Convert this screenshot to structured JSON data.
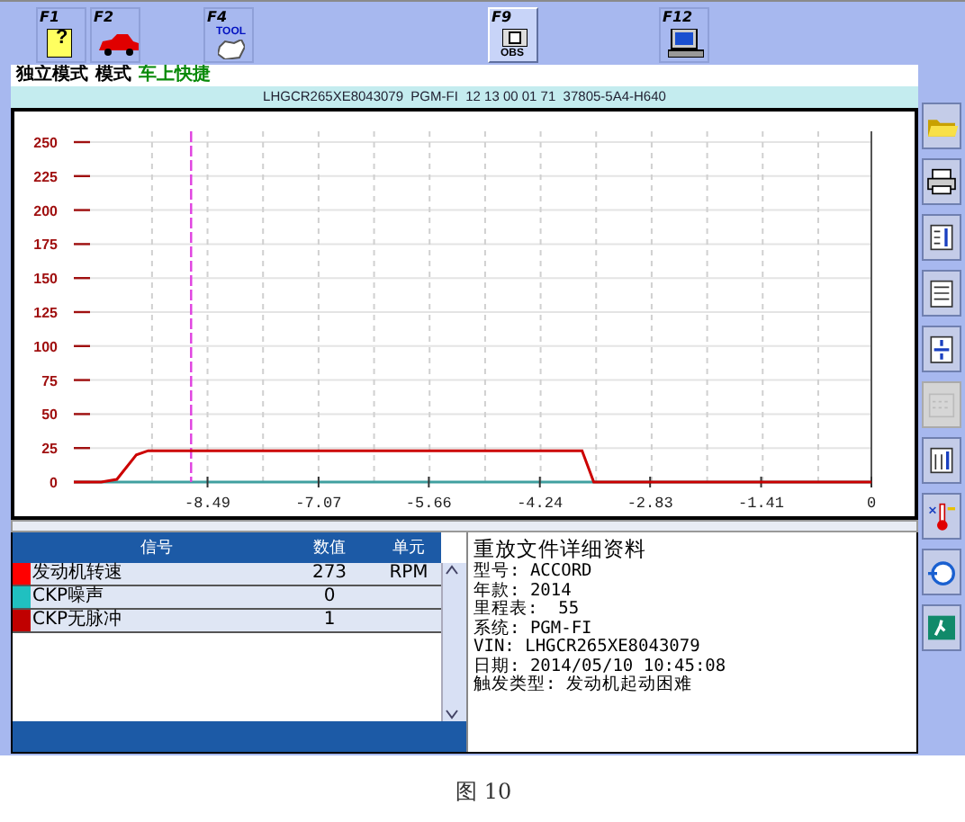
{
  "toolbar": {
    "keys": [
      {
        "label": "F1",
        "icon_text": "?",
        "selected": false
      },
      {
        "label": "F2",
        "selected": false
      },
      {
        "label": "F4",
        "icon_text": "TOOL",
        "selected": false
      },
      {
        "label": "F9",
        "icon_text": "OBS",
        "selected": true
      },
      {
        "label": "F12",
        "selected": false
      }
    ]
  },
  "mode_bar": {
    "parts": [
      {
        "text": "独立模式",
        "kind": "plain"
      },
      {
        "text": "模式",
        "kind": "plain"
      },
      {
        "text": "车上快捷",
        "kind": "highlight"
      }
    ]
  },
  "vehicle_strip": {
    "text": "LHGCR265XE8043079  PGM-FI  12 13 00 01 71  37805-5A4-H640"
  },
  "chart": {
    "chart_data": {
      "type": "line",
      "xlim": [
        -10.2,
        0
      ],
      "ylim": [
        0,
        250
      ],
      "yticks": [
        0,
        25,
        50,
        75,
        100,
        125,
        150,
        175,
        200,
        225,
        250
      ],
      "xticks": [
        {
          "value": -8.49,
          "label": "-8.49"
        },
        {
          "value": -7.07,
          "label": "-7.07"
        },
        {
          "value": -5.66,
          "label": "-5.66"
        },
        {
          "value": -4.24,
          "label": "-4.24"
        },
        {
          "value": -2.83,
          "label": "-2.83"
        },
        {
          "value": -1.41,
          "label": "-1.41"
        },
        {
          "value": 0,
          "label": "0"
        }
      ],
      "x": [
        -10.2,
        -9.85,
        -9.65,
        -9.4,
        -9.25,
        -3.7,
        -3.55,
        0
      ],
      "series": [
        {
          "color": "#cc0000",
          "values": [
            0,
            0,
            2,
            20,
            23,
            23,
            0,
            0
          ]
        }
      ],
      "grid": true,
      "ref_lines": [
        {
          "axis": "x",
          "value": -8.7,
          "color": "#e040e0"
        }
      ]
    }
  },
  "side_tools": [
    {
      "disabled": false
    },
    {
      "disabled": false
    },
    {
      "disabled": false
    },
    {
      "disabled": false
    },
    {
      "disabled": false
    },
    {
      "disabled": true
    },
    {
      "disabled": false
    },
    {
      "disabled": false
    },
    {
      "disabled": false
    },
    {
      "disabled": false
    }
  ],
  "signal_table": {
    "columns": [
      "信号",
      "数值",
      "单元"
    ],
    "rows": [
      {
        "color": "#ff0000",
        "name": "发动机转速",
        "value": "273",
        "unit": "RPM"
      },
      {
        "color": "#20c0c0",
        "name": "CKP噪声",
        "value": "0",
        "unit": ""
      },
      {
        "color": "#c00000",
        "name": "CKP无脉冲",
        "value": "1",
        "unit": ""
      }
    ]
  },
  "details": {
    "title": "重放文件详细资料",
    "lines": [
      "型号: ACCORD",
      "年款: 2014",
      "里程表:  55",
      "系统: PGM-FI",
      "VIN: LHGCR265XE8043079",
      "日期: 2014/05/10 10:45:08",
      "触发类型: 发动机起动困难"
    ]
  },
  "caption": "图 10"
}
